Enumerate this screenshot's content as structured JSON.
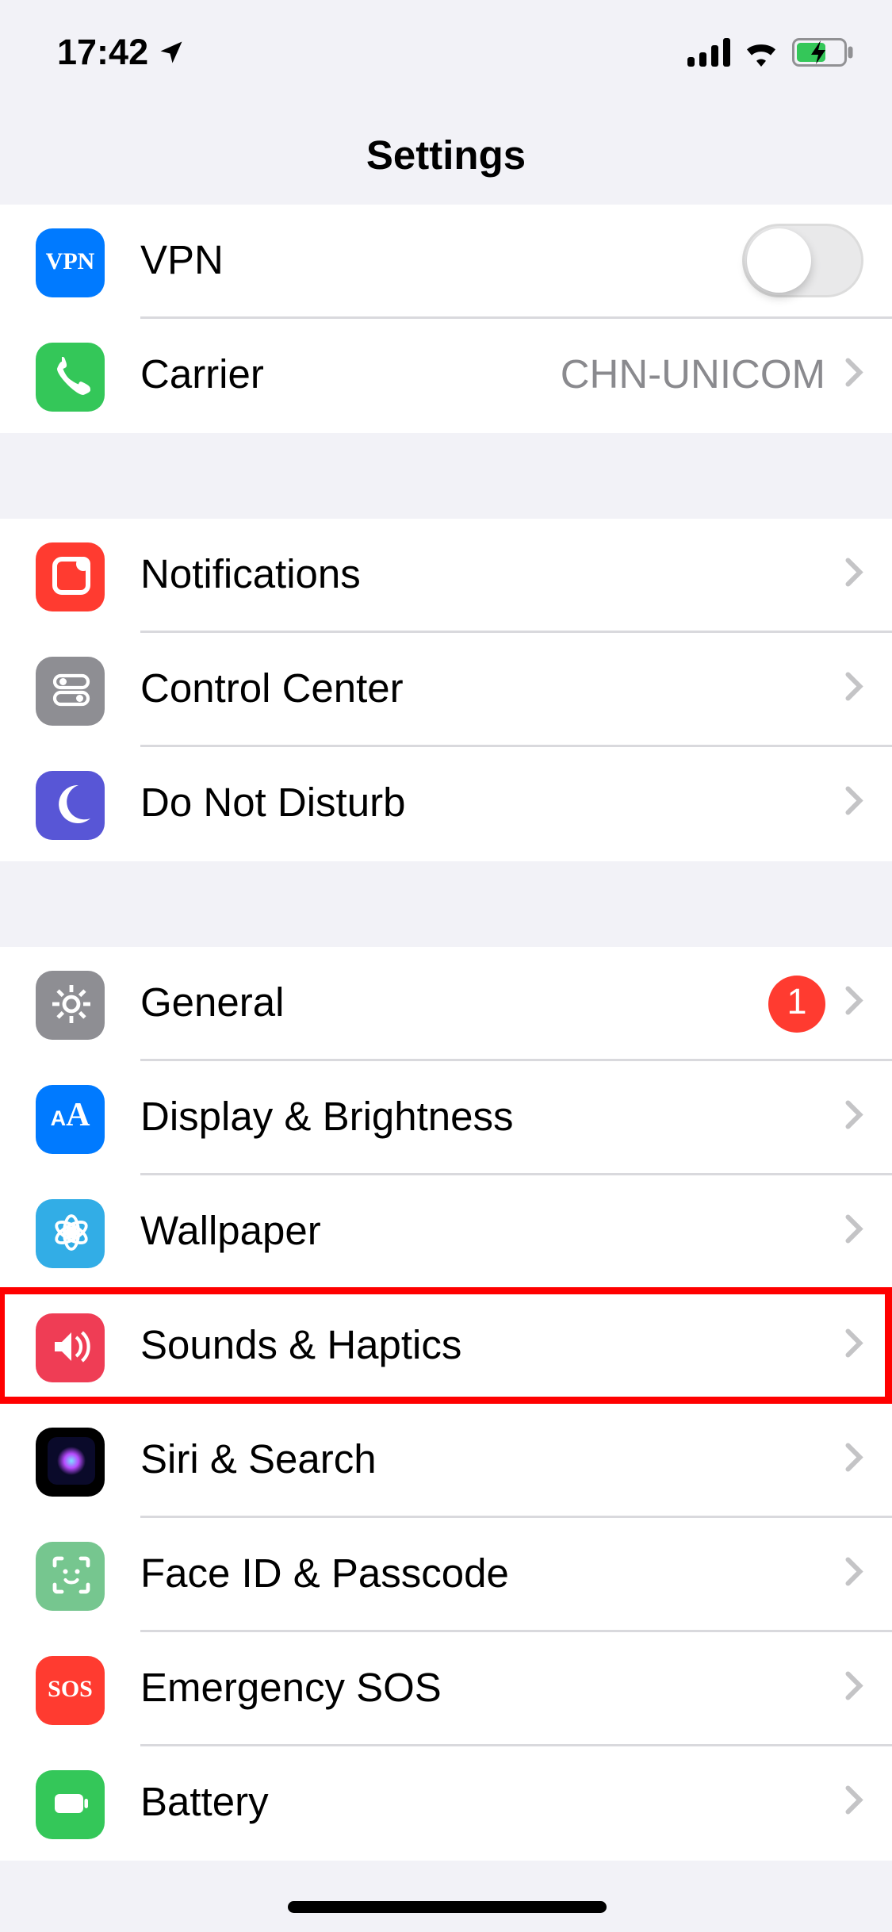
{
  "statusbar": {
    "time": "17:42"
  },
  "nav": {
    "title": "Settings"
  },
  "groups": [
    {
      "rows": [
        {
          "key": "vpn",
          "icon": "vpn",
          "icon_color": "#007aff",
          "label": "VPN",
          "accessory": "toggle",
          "toggle_on": false
        },
        {
          "key": "carrier",
          "icon": "phone",
          "icon_color": "#34c759",
          "label": "Carrier",
          "accessory": "disclosure",
          "detail": "CHN-UNICOM"
        }
      ]
    },
    {
      "rows": [
        {
          "key": "notifications",
          "icon": "notifications",
          "icon_color": "#ff3b30",
          "label": "Notifications",
          "accessory": "disclosure"
        },
        {
          "key": "controlcenter",
          "icon": "switches",
          "icon_color": "#8e8e93",
          "label": "Control Center",
          "accessory": "disclosure"
        },
        {
          "key": "dnd",
          "icon": "moon",
          "icon_color": "#5856d6",
          "label": "Do Not Disturb",
          "accessory": "disclosure"
        }
      ]
    },
    {
      "rows": [
        {
          "key": "general",
          "icon": "gear",
          "icon_color": "#8e8e93",
          "label": "General",
          "accessory": "disclosure",
          "badge": "1"
        },
        {
          "key": "display",
          "icon": "aa",
          "icon_color": "#007aff",
          "label": "Display & Brightness",
          "accessory": "disclosure"
        },
        {
          "key": "wallpaper",
          "icon": "flower",
          "icon_color": "#32ade6",
          "label": "Wallpaper",
          "accessory": "disclosure"
        },
        {
          "key": "sounds",
          "icon": "speaker",
          "icon_color": "#ef3d55",
          "label": "Sounds & Haptics",
          "accessory": "disclosure",
          "highlighted": true
        },
        {
          "key": "siri",
          "icon": "siri",
          "icon_color": "#000000",
          "label": "Siri & Search",
          "accessory": "disclosure"
        },
        {
          "key": "faceid",
          "icon": "face",
          "icon_color": "#76c68f",
          "label": "Face ID & Passcode",
          "accessory": "disclosure"
        },
        {
          "key": "sos",
          "icon": "sos",
          "icon_color": "#ff3b30",
          "label": "Emergency SOS",
          "accessory": "disclosure"
        },
        {
          "key": "battery",
          "icon": "battery",
          "icon_color": "#34c759",
          "label": "Battery",
          "accessory": "disclosure"
        }
      ]
    }
  ],
  "scroll_offset_pt": 2
}
